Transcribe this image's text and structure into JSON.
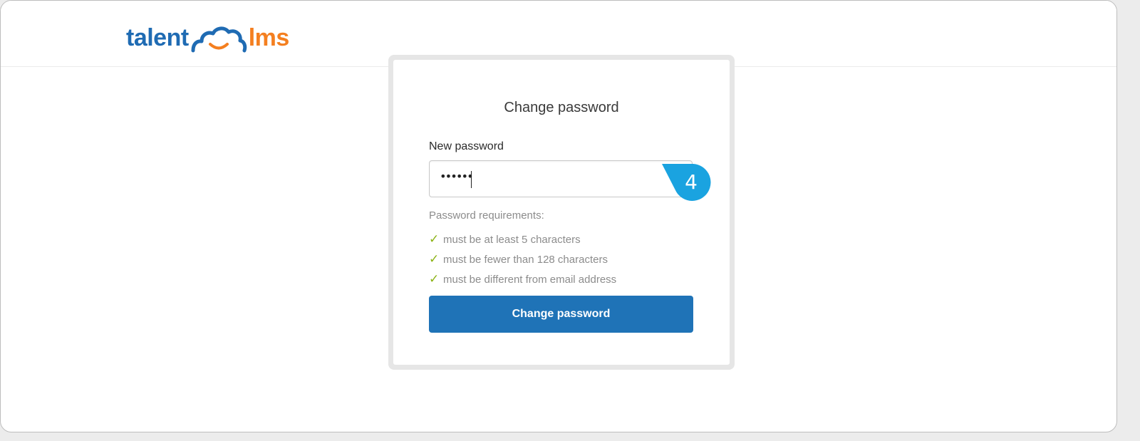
{
  "brand": {
    "logo_text_left": "talent",
    "logo_text_right": "lms",
    "primary_color": "#1f6bb3",
    "accent_color": "#f47f20"
  },
  "form": {
    "title": "Change password",
    "new_password_label": "New password",
    "new_password_value": "••••••",
    "requirements_title": "Password requirements:",
    "requirements": [
      {
        "text": "must be at least 5 characters",
        "met": true
      },
      {
        "text": "must be fewer than 128 characters",
        "met": true
      },
      {
        "text": "must be different from email address",
        "met": true
      }
    ],
    "submit_label": "Change password",
    "button_color": "#1f73b7"
  },
  "callout": {
    "number": "4",
    "color": "#1aa3e0"
  },
  "icons": {
    "check": "check-icon",
    "logo": "talentlms-cloud-icon"
  }
}
